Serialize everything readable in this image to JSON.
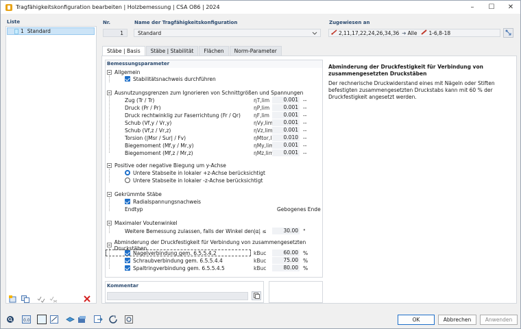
{
  "window": {
    "title": "Tragfähigkeitskonfiguration bearbeiten | Holzbemessung | CSA O86 | 2024",
    "controls": [
      "–",
      "☐",
      "✕"
    ]
  },
  "list": {
    "label": "Liste",
    "items": [
      {
        "num": "1",
        "name": "Standard"
      }
    ]
  },
  "nr": {
    "label": "Nr.",
    "value": "1"
  },
  "name_field": {
    "label": "Name der Tragfähigkeitskonfiguration",
    "value": "Standard"
  },
  "assigned": {
    "label": "Zugewiesen an",
    "members": "2,11,17,22,24,26,34,36",
    "all": "Alle",
    "sets": "1-6,8-18"
  },
  "tabs": [
    "Stäbe | Basis",
    "Stäbe | Stabilität",
    "Flächen",
    "Norm-Parameter"
  ],
  "params": {
    "title": "Bemessungsparameter",
    "general": {
      "header": "Allgemein",
      "stability": "Stabilitätsnachweis durchführen"
    },
    "limits": {
      "header": "Ausnutzungsgrenzen zum Ignorieren von Schnittgrößen und Spannungen",
      "rows": [
        {
          "label": "Zug (Tr / Tr)",
          "sym": "ηT,lim",
          "val": "0.001",
          "unit": "--"
        },
        {
          "label": "Druck (Pr / Pr)",
          "sym": "ηP,lim",
          "val": "0.001",
          "unit": "--"
        },
        {
          "label": "Druck rechtwinklig zur Faserrichtung (Fr / Qr)",
          "sym": "ηF,lim",
          "val": "0.001",
          "unit": "--"
        },
        {
          "label": "Schub (Vf,y / Vr,y)",
          "sym": "ηVy,lim",
          "val": "0.001",
          "unit": "--"
        },
        {
          "label": "Schub (Vf,z / Vr,z)",
          "sym": "ηVz,lim",
          "val": "0.001",
          "unit": "--"
        },
        {
          "label": "Torsion (|Msr / Sur| / Fv)",
          "sym": "ηMtor,lim",
          "val": "0.010",
          "unit": "--"
        },
        {
          "label": "Biegemoment (Mf,y / Mr,y)",
          "sym": "ηMy,lim",
          "val": "0.001",
          "unit": "--"
        },
        {
          "label": "Biegemoment (Mf,z / Mr,z)",
          "sym": "ηMz,lim",
          "val": "0.001",
          "unit": "--"
        }
      ]
    },
    "bending": {
      "header": "Positive oder negative Biegung um y-Achse",
      "opt1": "Untere Stabseite in lokaler +z-Achse berücksichtigt",
      "opt2": "Untere Stabseite in lokaler -z-Achse berücksichtigt"
    },
    "curved": {
      "header": "Gekrümmte Stäbe",
      "radial": "Radialspannungsnachweis",
      "endtyp_label": "Endtyp",
      "endtyp_value": "Gebogenes Ende"
    },
    "haunch": {
      "header": "Maximaler Voutenwinkel",
      "label": "Weitere Bemessung zulassen, falls der Winkel den ...",
      "sym": "|α| ≤",
      "val": "30.00",
      "unit": "°"
    },
    "reduction": {
      "header": "Abminderung der Druckfestigkeit für Verbindung von zusammengesetzten Druckstäben",
      "rows": [
        {
          "label": "Nagelverbindung gem. 6.5.5.4.2",
          "sym": "kBuc",
          "val": "60.00",
          "unit": "%"
        },
        {
          "label": "Schraubverbindung gem. 6.5.5.4.4",
          "sym": "kBuc",
          "val": "75.00",
          "unit": "%"
        },
        {
          "label": "Spaltringverbindung gem. 6.5.5.4.5",
          "sym": "kBuc",
          "val": "80.00",
          "unit": "%"
        }
      ]
    }
  },
  "description": {
    "title": "Abminderung der Druckfestigkeit für Verbindung von zusammengesetzten Druckstäben",
    "body": "Der rechnerische Druckwiderstand eines mit Nägeln oder Stiften befestigten zusammengesetzten Druckstabs kann mit 60 % der Druckfestigkeit angesetzt werden."
  },
  "comment": {
    "label": "Kommentar",
    "value": ""
  },
  "footer": {
    "ok": "OK",
    "cancel": "Abbrechen",
    "apply": "Anwenden"
  }
}
